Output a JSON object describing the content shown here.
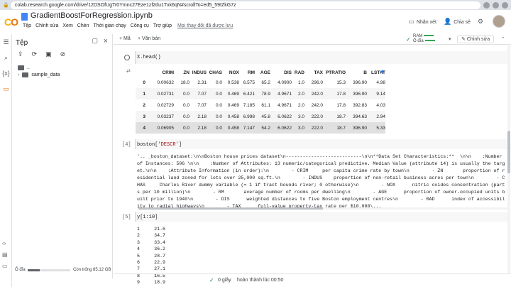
{
  "browser": {
    "url": "colab.research.google.com/drive/12DSOfUgTr0Ymnc27Eze1zf2du1Txk6qN#scrollTo=ed5_59IZkG7z"
  },
  "header": {
    "notebook_title": "GradientBoostForRegression.ipynb",
    "menu": [
      "Tệp",
      "Chỉnh sửa",
      "Xem",
      "Chèn",
      "Thời gian chạy",
      "Công cụ",
      "Trợ giúp"
    ],
    "saved_status": "Mọi thay đổi đã được lưu",
    "comment_label": "Nhận xét",
    "share_label": "Chia sẻ"
  },
  "side_panel": {
    "title": "Tệp",
    "tree": [
      {
        "label": ".."
      },
      {
        "label": "sample_data"
      }
    ],
    "disk_label": "Ổ đĩa",
    "disk_free": "Còn trống 85.12 GB",
    "disk_used_fraction": 0.28
  },
  "toolbar": {
    "add_code": "+ Mã",
    "add_text": "+ Văn bản",
    "ram_label": "RAM",
    "disk_label": "Ổ đĩa",
    "edit_label": "Chỉnh sửa"
  },
  "cells": {
    "c1": {
      "code": "X.head()"
    },
    "c2": {
      "number": "[4]",
      "code_prefix": "boston[",
      "code_str": "'DESCR'",
      "code_suffix": "]"
    },
    "c3": {
      "number": "[5]",
      "code": "y[1:10]"
    }
  },
  "dataframe": {
    "columns": [
      "",
      "CRIM",
      "ZN",
      "INDUS",
      "CHAS",
      "NOX",
      "RM",
      "AGE",
      "DIS",
      "RAD",
      "TAX",
      "PTRATIO",
      "B",
      "LSTAT"
    ],
    "rows": [
      [
        "0",
        "0.00632",
        "18.0",
        "2.31",
        "0.0",
        "0.538",
        "6.575",
        "65.2",
        "4.0900",
        "1.0",
        "296.0",
        "15.3",
        "396.90",
        "4.98"
      ],
      [
        "1",
        "0.02731",
        "0.0",
        "7.07",
        "0.0",
        "0.469",
        "6.421",
        "78.9",
        "4.9671",
        "2.0",
        "242.0",
        "17.8",
        "396.90",
        "9.14"
      ],
      [
        "2",
        "0.02729",
        "0.0",
        "7.07",
        "0.0",
        "0.469",
        "7.185",
        "61.1",
        "4.9671",
        "2.0",
        "242.0",
        "17.8",
        "392.83",
        "4.03"
      ],
      [
        "3",
        "0.03237",
        "0.0",
        "2.18",
        "0.0",
        "0.458",
        "6.998",
        "45.8",
        "6.0622",
        "3.0",
        "222.0",
        "18.7",
        "394.63",
        "2.94"
      ],
      [
        "4",
        "0.06905",
        "0.0",
        "2.18",
        "0.0",
        "0.458",
        "7.147",
        "54.2",
        "6.0622",
        "3.0",
        "222.0",
        "18.7",
        "396.90",
        "5.33"
      ]
    ]
  },
  "describe_output": "'.. _boston_dataset:\\n\\nBoston house prices dataset\\n---------------------------\\n\\n**Data Set Characteristics:**  \\n\\n    :Number of Instances: 506 \\n\\n    :Number of Attributes: 13 numeric/categorical predictive. Median Value (attribute 14) is usually the target.\\n\\n    :Attribute Information (in order):\\n        - CRIM     per capita crime rate by town\\n        - ZN       proportion of residential land zoned for lots over 25,000 sq.ft.\\n        - INDUS    proportion of non-retail business acres per town\\n        - CHAS     Charles River dummy variable (= 1 if tract bounds river; 0 otherwise)\\n        - NOX      nitric oxides concentration (parts per 10 million)\\n        - RM       average number of rooms per dwelling\\n        - AGE      proportion of owner-occupied units built prior to 1940\\n        - DIS      weighted distances to five Boston employment centres\\n        - RAD      index of accessibility to radial highways\\n        - TAX      full-value property-tax rate per $10,000\\...",
  "y_output": [
    [
      "1",
      "21.6"
    ],
    [
      "2",
      "34.7"
    ],
    [
      "3",
      "33.4"
    ],
    [
      "4",
      "36.2"
    ],
    [
      "5",
      "28.7"
    ],
    [
      "6",
      "22.9"
    ],
    [
      "7",
      "27.1"
    ],
    [
      "8",
      "16.5"
    ],
    [
      "9",
      "18.9"
    ]
  ],
  "status": {
    "elapsed": "0 giây",
    "completed": "hoàn thành lúc 00:50"
  }
}
